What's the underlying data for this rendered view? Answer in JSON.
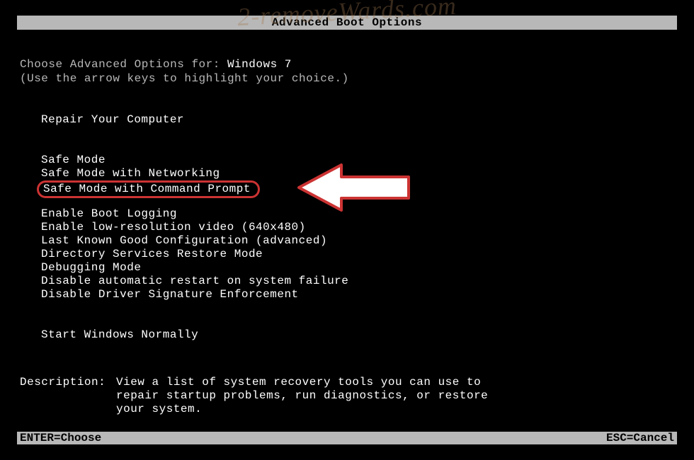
{
  "watermark": "2-removeWards.com",
  "title": "Advanced Boot Options",
  "prompt_prefix": "Choose Advanced Options for: ",
  "os_name": "Windows 7",
  "hint": "(Use the arrow keys to highlight your choice.)",
  "menu": {
    "group1": [
      "Repair Your Computer"
    ],
    "group2": [
      "Safe Mode",
      "Safe Mode with Networking"
    ],
    "highlighted": "Safe Mode with Command Prompt",
    "group3": [
      "Enable Boot Logging",
      "Enable low-resolution video (640x480)",
      "Last Known Good Configuration (advanced)",
      "Directory Services Restore Mode",
      "Debugging Mode",
      "Disable automatic restart on system failure",
      "Disable Driver Signature Enforcement"
    ],
    "group4": [
      "Start Windows Normally"
    ]
  },
  "description": {
    "label": "Description:",
    "text": "View a list of system recovery tools you can use to repair startup problems, run diagnostics, or restore your system."
  },
  "footer": {
    "enter": "ENTER=Choose",
    "esc": "ESC=Cancel"
  }
}
